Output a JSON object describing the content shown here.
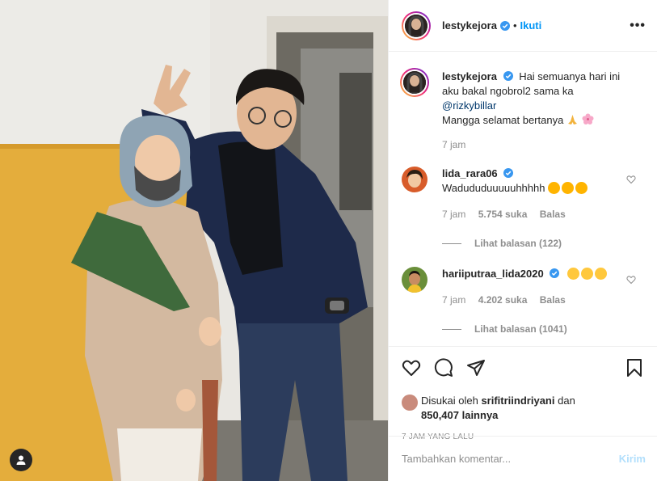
{
  "post": {
    "username": "lestykejora",
    "follow_label": "Ikuti",
    "more_label": "•••",
    "caption_lines": [
      "Hai semuanya hari ini",
      "aku bakal ngobrol2 sama ka",
      "@rizkybillar",
      "Mangga selamat bertanya"
    ],
    "caption_time": "7 jam"
  },
  "comments": [
    {
      "username": "lida_rara06",
      "text": "Wadududuuuuuhhhhh",
      "time": "7 jam",
      "likes": "5.754 suka",
      "reply_label": "Balas",
      "view_replies": "Lihat balasan (122)"
    },
    {
      "username": "hariiputraa_lida2020",
      "text": "",
      "time": "7 jam",
      "likes": "4.202 suka",
      "reply_label": "Balas",
      "view_replies": "Lihat balasan (1041)"
    }
  ],
  "likes": {
    "prefix": "Disukai oleh",
    "user": "srifitriindriyani",
    "middle": "dan",
    "count": "850,407 lainnya"
  },
  "posted_ago": "7 JAM YANG LALU",
  "composer": {
    "placeholder": "Tambahkan komentar...",
    "send_label": "Kirim"
  },
  "colors": {
    "accent": "#0095f6",
    "send_disabled": "#b2dffc",
    "muted": "#8e8e8e"
  },
  "icons": [
    "heart-icon",
    "comment-icon",
    "share-icon",
    "bookmark-icon",
    "verified-icon",
    "user-tag-icon"
  ]
}
